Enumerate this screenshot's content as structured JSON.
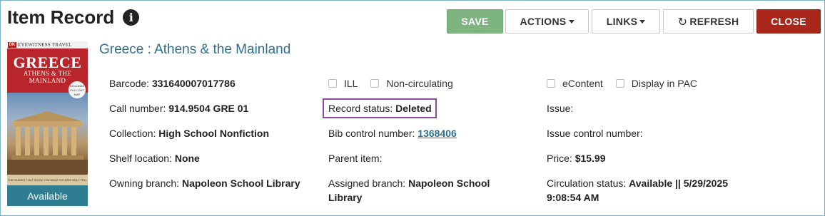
{
  "window": {
    "title": "Item Record"
  },
  "toolbar": {
    "save": "SAVE",
    "actions": "ACTIONS",
    "links": "LINKS",
    "refresh": "REFRESH",
    "close": "CLOSE"
  },
  "cover": {
    "publisher_logo": "DK",
    "series": "EYEWITNESS TRAVEL",
    "title": "GREECE",
    "subtitle": "ATHENS & THE MAINLAND",
    "badge": "INCLUDES PULL-OUT MAP",
    "tagline": "THE GUIDES THAT SHOW YOU WHAT OTHERS ONLY TELL YOU",
    "availability": "Available"
  },
  "item": {
    "bib_title": "Greece : Athens & the Mainland",
    "col1": {
      "barcode_label": "Barcode:",
      "barcode": "331640007017786",
      "call_number_label": "Call number:",
      "call_number": "914.9504 GRE 01",
      "collection_label": "Collection:",
      "collection": "High School Nonfiction",
      "shelf_location_label": "Shelf location:",
      "shelf_location": "None",
      "owning_branch_label": "Owning branch:",
      "owning_branch": "Napoleon School Library"
    },
    "col2": {
      "ill_label": "ILL",
      "noncirc_label": "Non-circulating",
      "record_status_label": "Record status:",
      "record_status": "Deleted",
      "bib_control_label": "Bib control number:",
      "bib_control": "1368406",
      "parent_item_label": "Parent item:",
      "assigned_branch_label": "Assigned branch:",
      "assigned_branch_line1": "Napoleon School",
      "assigned_branch_line2": "Library"
    },
    "col3": {
      "econtent_label": "eContent",
      "display_pac_label": "Display in PAC",
      "issue_label": "Issue:",
      "issue_control_label": "Issue control number:",
      "price_label": "Price:",
      "price": "$15.99",
      "circ_status_label": "Circulation status:",
      "circ_status_line1": "Available || 5/29/2025",
      "circ_status_line2": "9:08:54 AM"
    }
  },
  "colors": {
    "save_green": "#7db47f",
    "close_red": "#a8261a",
    "link_blue": "#2e6f8e",
    "highlight_purple": "#8e4aa0",
    "available_teal": "#2e7d91"
  }
}
